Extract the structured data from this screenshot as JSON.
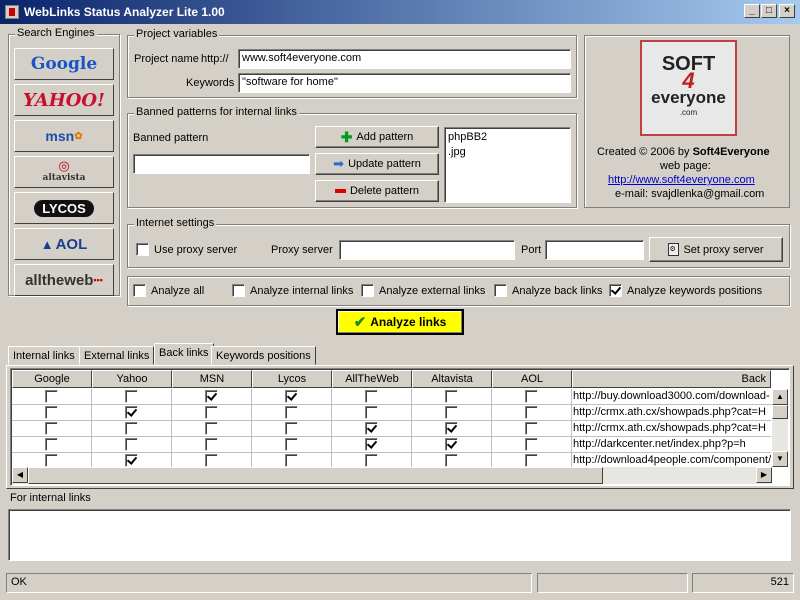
{
  "window": {
    "title": "WebLinks Status Analyzer Lite 1.00"
  },
  "search_engines": {
    "legend": "Search Engines",
    "items": [
      "Google",
      "YAHOO!",
      "msn",
      "altavista",
      "LYCOS",
      "AOL",
      "alltheweb"
    ]
  },
  "project": {
    "legend": "Project variables",
    "name_label": "Project name",
    "prefix": "http://",
    "name_value": "www.soft4everyone.com",
    "keywords_label": "Keywords",
    "keywords_value": "\"software for home\""
  },
  "banned": {
    "legend": "Banned patterns for internal links",
    "pattern_label": "Banned pattern",
    "pattern_value": "",
    "add_label": "Add pattern",
    "update_label": "Update pattern",
    "delete_label": "Delete pattern",
    "patterns": [
      "phpBB2",
      ".jpg"
    ]
  },
  "about": {
    "logo_line1": "SOFT",
    "logo_line2": "4",
    "logo_line3": "everyone",
    "logo_line4": ".com",
    "created": "Created © 2006 by",
    "company": "Soft4Everyone",
    "webpage_label": "web page:",
    "url": "http://www.soft4everyone.com",
    "email_label": "e-mail:",
    "email": "svajdlenka@gmail.com"
  },
  "internet": {
    "legend": "Internet settings",
    "use_proxy_label": "Use proxy server",
    "use_proxy_checked": false,
    "proxy_label": "Proxy server",
    "proxy_value": "",
    "port_label": "Port",
    "port_value": "",
    "set_proxy_label": "Set proxy server"
  },
  "analyze_options": [
    {
      "label": "Analyze all",
      "checked": false
    },
    {
      "label": "Analyze internal links",
      "checked": false
    },
    {
      "label": "Analyze external links",
      "checked": false
    },
    {
      "label": "Analyze back links",
      "checked": false
    },
    {
      "label": "Analyze keywords positions",
      "checked": true
    }
  ],
  "analyze_button": "Analyze links",
  "tabs": [
    "Internal links",
    "External links",
    "Back links",
    "Keywords positions"
  ],
  "active_tab": "Back links",
  "grid": {
    "columns": [
      "Google",
      "Yahoo",
      "MSN",
      "Lycos",
      "AllTheWeb",
      "Altavista",
      "AOL",
      "Back"
    ],
    "rows": [
      {
        "checks": [
          false,
          false,
          true,
          true,
          false,
          false,
          false
        ],
        "url": "http://buy.download3000.com/download-"
      },
      {
        "checks": [
          false,
          true,
          false,
          false,
          false,
          false,
          false
        ],
        "url": "http://crmx.ath.cx/showpads.php?cat=H"
      },
      {
        "checks": [
          false,
          false,
          false,
          false,
          true,
          true,
          false
        ],
        "url": "http://crmx.ath.cx/showpads.php?cat=H"
      },
      {
        "checks": [
          false,
          false,
          false,
          false,
          true,
          true,
          false
        ],
        "url": "http://darkcenter.net/index.php?p=h"
      },
      {
        "checks": [
          false,
          true,
          false,
          false,
          false,
          false,
          false
        ],
        "url": "http://download4people.com/component/"
      }
    ]
  },
  "internal_links": {
    "label": "For internal links",
    "value": ""
  },
  "status": {
    "text": "OK",
    "count": "521"
  }
}
